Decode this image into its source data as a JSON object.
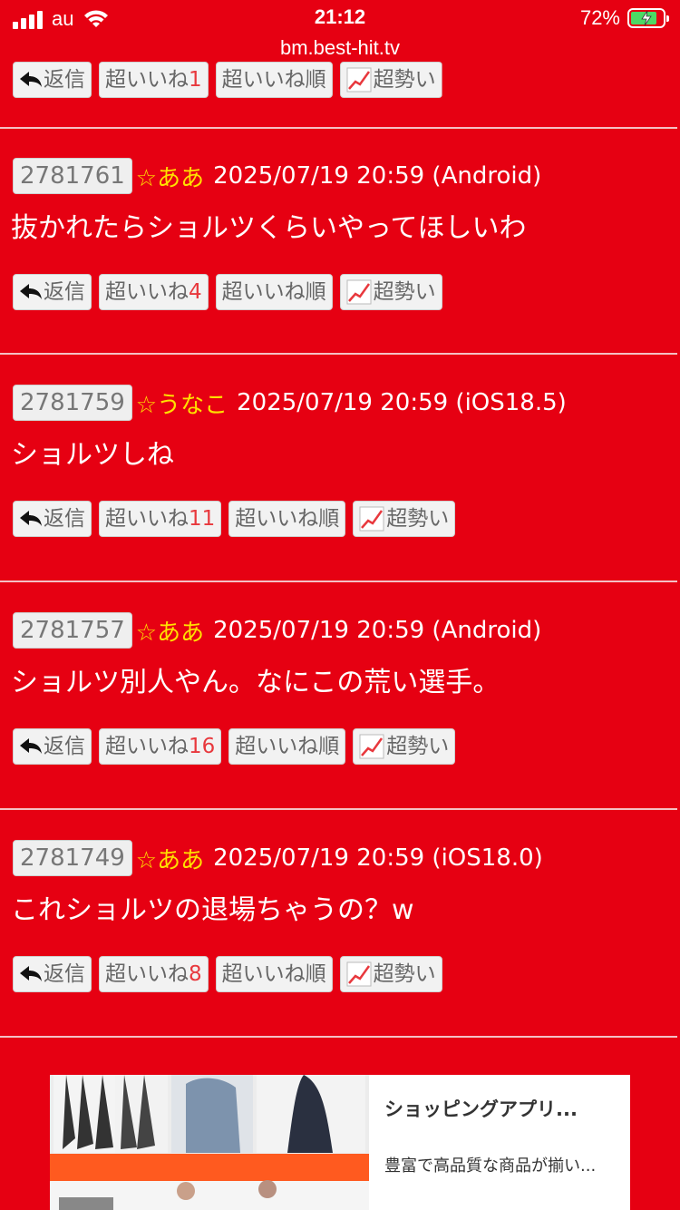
{
  "status_bar": {
    "carrier": "au",
    "time": "21:12",
    "battery": "72%",
    "battery_level": 0.72
  },
  "browser": {
    "url": "bm.best-hit.tv"
  },
  "buttons": {
    "reply": "返信",
    "like": "超いいね",
    "like_order": "超いいね順",
    "trend": "超勢い"
  },
  "top_partial": {
    "like_count": "1"
  },
  "posts": [
    {
      "number": "2781761",
      "name": "☆ああ",
      "datetime": "2025/07/19 20:59 (Android)",
      "body": "抜かれたらショルツくらいやってほしいわ",
      "like_count": "4"
    },
    {
      "number": "2781759",
      "name": "☆うなこ",
      "datetime": "2025/07/19 20:59 (iOS18.5)",
      "body": "ショルツしね",
      "like_count": "11"
    },
    {
      "number": "2781757",
      "name": "☆ああ",
      "datetime": "2025/07/19 20:59 (Android)",
      "body": "ショルツ別人やん。なにこの荒い選手。",
      "like_count": "16"
    },
    {
      "number": "2781749",
      "name": "☆ああ",
      "datetime": "2025/07/19 20:59 (iOS18.0)",
      "body": "これショルツの退場ちゃうの？w",
      "like_count": "8"
    }
  ],
  "ad": {
    "title": "ショッピングアプリ...",
    "description": "豊富で高品質な商品が揃い..."
  },
  "colors": {
    "background": "#e60012",
    "name": "#ffe100",
    "like_count": "#e8383d"
  }
}
